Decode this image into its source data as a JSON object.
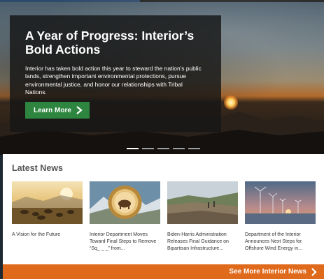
{
  "hero": {
    "title": "A Year of Progress: Interior’s Bold Actions",
    "body": "Interior has taken bold action this year to steward the nation’s public lands, strengthen important environmental protections, pursue environmental justice, and honor our relationships with Tribal Nations.",
    "button_label": "Learn More",
    "slides_total": 5,
    "slide_active": 1
  },
  "news": {
    "heading": "Latest News",
    "items": [
      {
        "title": "A Vision for the Future",
        "thumb": "bison-herd-sunset"
      },
      {
        "title": "Interior Department Moves Toward Final Steps to Remove “Sq_ _ _” from...",
        "thumb": "department-of-interior-seal"
      },
      {
        "title": "Biden-Harris Administration Releases Final Guidance on Bipartisan Infrastructure...",
        "thumb": "mined-land-landscape"
      },
      {
        "title": "Department of the Interior Announces Next Steps for Offshore Wind Energy in...",
        "thumb": "wind-turbines-sunset"
      }
    ],
    "see_more_label": "See More Interior News"
  },
  "colors": {
    "green_button": "#2e8540",
    "orange_bar": "#e06a1c",
    "card_overlay": "#161616"
  }
}
